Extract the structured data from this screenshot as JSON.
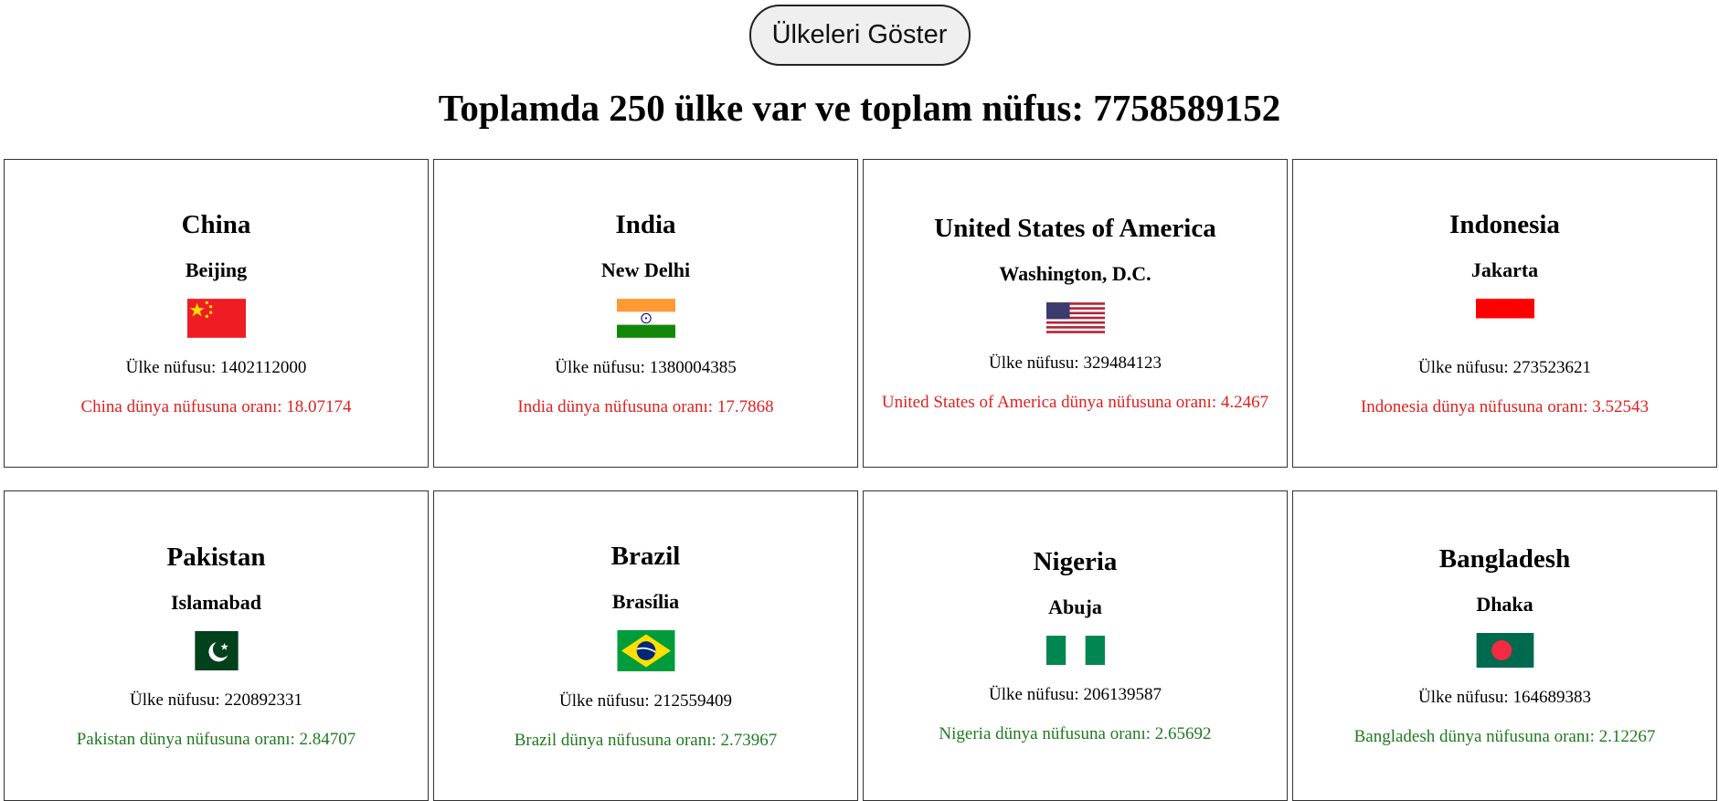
{
  "header": {
    "show_button_label": "Ülkeleri Göster",
    "summary": "Toplamda 250 ülke var ve toplam nüfus: 7758589152"
  },
  "colors": {
    "high_ratio": "#e02020",
    "low_ratio": "#1f7a1f"
  },
  "countries": [
    {
      "name": "China",
      "capital": "Beijing",
      "flag": "china-flag-icon",
      "population": "Ülke nüfusu: 1402112000",
      "ratio": "China dünya nüfusuna oranı: 18.07174",
      "ratio_color": "red"
    },
    {
      "name": "India",
      "capital": "New Delhi",
      "flag": "india-flag-icon",
      "population": "Ülke nüfusu: 1380004385",
      "ratio": "India dünya nüfusuna oranı: 17.7868",
      "ratio_color": "red"
    },
    {
      "name": "United States of America",
      "capital": "Washington, D.C.",
      "flag": "usa-flag-icon",
      "population": "Ülke nüfusu: 329484123",
      "ratio": "United States of America dünya nüfusuna oranı: 4.2467",
      "ratio_color": "red"
    },
    {
      "name": "Indonesia",
      "capital": "Jakarta",
      "flag": "indonesia-flag-icon",
      "population": "Ülke nüfusu: 273523621",
      "ratio": "Indonesia dünya nüfusuna oranı: 3.52543",
      "ratio_color": "red"
    },
    {
      "name": "Pakistan",
      "capital": "Islamabad",
      "flag": "pakistan-flag-icon",
      "population": "Ülke nüfusu: 220892331",
      "ratio": "Pakistan dünya nüfusuna oranı: 2.84707",
      "ratio_color": "green"
    },
    {
      "name": "Brazil",
      "capital": "Brasília",
      "flag": "brazil-flag-icon",
      "population": "Ülke nüfusu: 212559409",
      "ratio": "Brazil dünya nüfusuna oranı: 2.73967",
      "ratio_color": "green"
    },
    {
      "name": "Nigeria",
      "capital": "Abuja",
      "flag": "nigeria-flag-icon",
      "population": "Ülke nüfusu: 206139587",
      "ratio": "Nigeria dünya nüfusuna oranı: 2.65692",
      "ratio_color": "green"
    },
    {
      "name": "Bangladesh",
      "capital": "Dhaka",
      "flag": "bangladesh-flag-icon",
      "population": "Ülke nüfusu: 164689383",
      "ratio": "Bangladesh dünya nüfusuna oranı: 2.12267",
      "ratio_color": "green"
    }
  ]
}
